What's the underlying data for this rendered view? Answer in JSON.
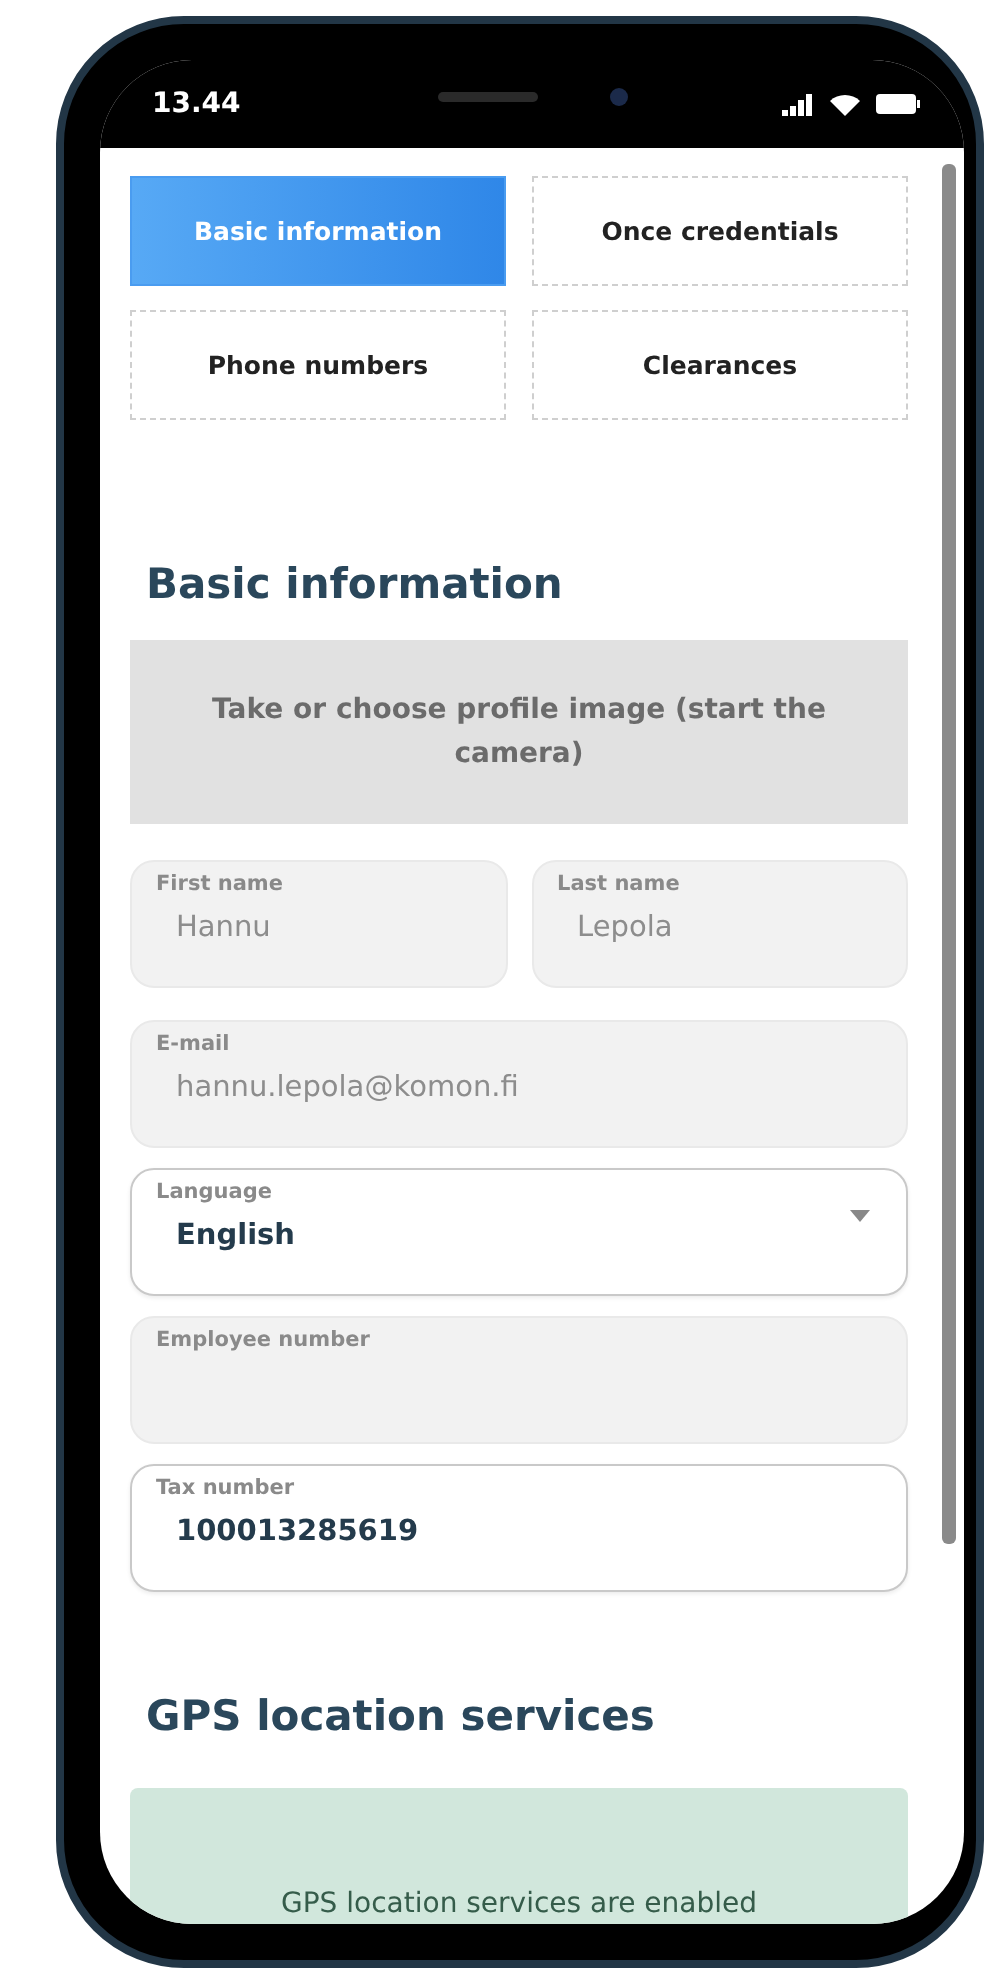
{
  "status_bar": {
    "time": "13.44"
  },
  "tabs": [
    {
      "label": "Basic information",
      "selected": true
    },
    {
      "label": "Once credentials",
      "selected": false
    },
    {
      "label": "Phone numbers",
      "selected": false
    },
    {
      "label": "Clearances",
      "selected": false
    }
  ],
  "basic_information": {
    "heading": "Basic information",
    "profile_image_button": "Take or choose profile image (start the camera)",
    "name_fields": [
      {
        "label": "First name",
        "value": "Hannu",
        "disabled": true,
        "kind": "text"
      },
      {
        "label": "Last name",
        "value": "Lepola",
        "disabled": true,
        "kind": "text"
      }
    ],
    "fields": [
      {
        "label": "E-mail",
        "value": "hannu.lepola@komon.fi",
        "disabled": true,
        "kind": "text"
      },
      {
        "label": "Language",
        "value": "English",
        "disabled": false,
        "kind": "select"
      },
      {
        "label": "Employee number",
        "disabled": true,
        "kind": "text"
      },
      {
        "label": "Tax number",
        "value": "100013285619",
        "disabled": false,
        "kind": "text"
      }
    ]
  },
  "gps": {
    "heading": "GPS location services",
    "status": "GPS location services are enabled"
  }
}
